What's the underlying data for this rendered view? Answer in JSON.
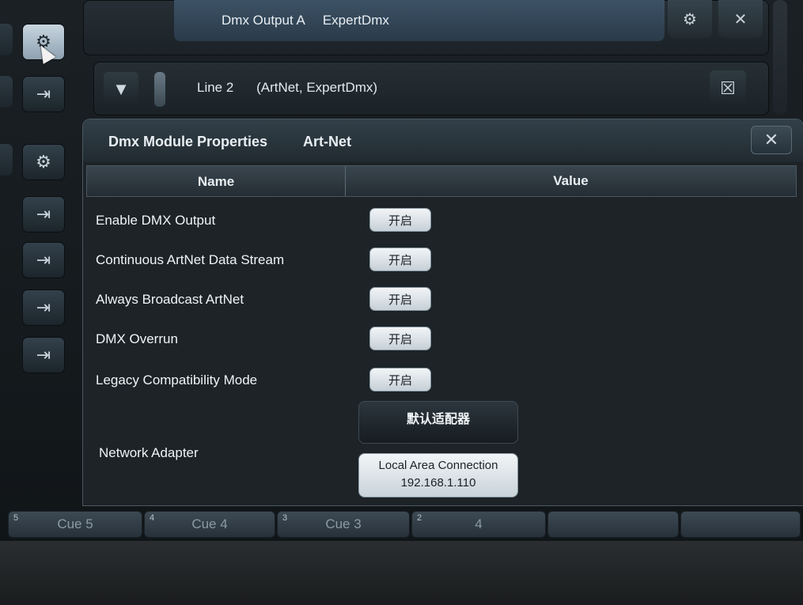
{
  "top_output": {
    "label": "Dmx Output A",
    "value": "ExpertDmx"
  },
  "line2": {
    "label": "Line 2",
    "detail": "(ArtNet, ExpertDmx)"
  },
  "dialog": {
    "title": "Dmx Module Properties",
    "module": "Art-Net",
    "columns": {
      "name": "Name",
      "value": "Value"
    },
    "properties": [
      {
        "label": "Enable DMX Output",
        "value": "开启"
      },
      {
        "label": "Continuous ArtNet Data Stream",
        "value": "开启"
      },
      {
        "label": "Always Broadcast ArtNet",
        "value": "开启"
      },
      {
        "label": "DMX Overrun",
        "value": "开启"
      },
      {
        "label": "Legacy Compatibility Mode",
        "value": "开启"
      }
    ],
    "network_adapter": {
      "label": "Network Adapter",
      "default_option": "默认适配器",
      "selected_name": "Local Area Connection",
      "selected_ip": "192.168.1.110"
    }
  },
  "cues": [
    {
      "num": "5",
      "label": "Cue 5"
    },
    {
      "num": "4",
      "label": "Cue 4"
    },
    {
      "num": "3",
      "label": "Cue 3"
    },
    {
      "num": "2",
      "label": "4"
    }
  ],
  "icons": {
    "settings": "gear-icon",
    "output": "arrow-to-bar-icon",
    "close": "close-icon",
    "expand": "triangle-down-icon",
    "delete": "delete-icon"
  },
  "colors": {
    "dialog_bg": "#1d2327",
    "toggle_bg": "#e6ecf0",
    "accent_blue": "#3c5266"
  }
}
